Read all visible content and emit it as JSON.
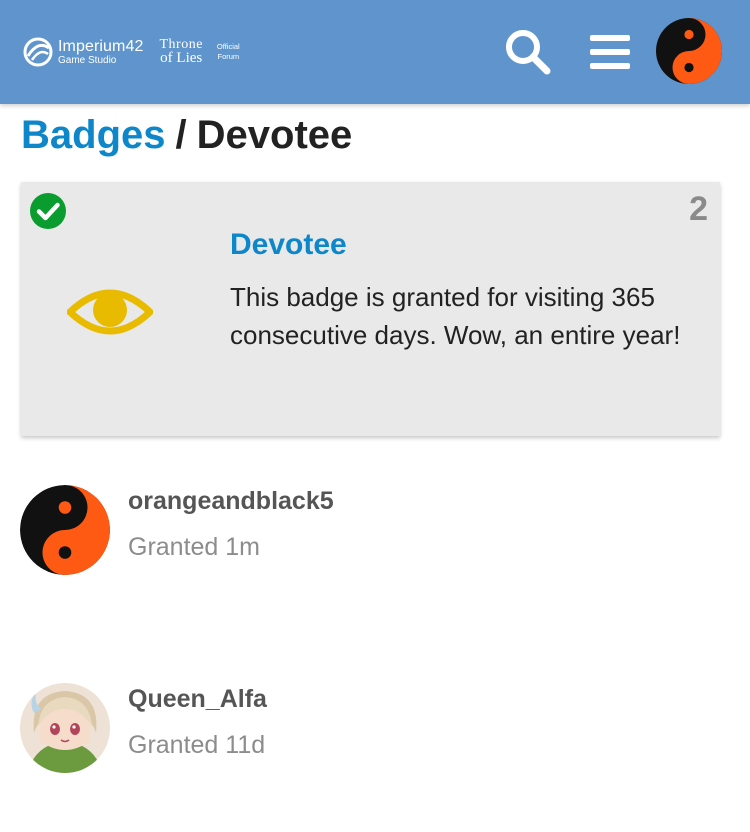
{
  "header": {
    "brand_name": "Imperium42",
    "brand_sub": "Game Studio",
    "game_title_top": "Throne",
    "game_title_bottom": "of Lies",
    "official_line1": "Official",
    "official_line2": "Forum",
    "icons": [
      "imperium42-logo-icon",
      "search-icon",
      "hamburger-menu-icon",
      "yin-yang-avatar"
    ],
    "bg_color": "#5f95cc"
  },
  "breadcrumb": {
    "parent": "Badges",
    "separator": "/",
    "current": "Devotee"
  },
  "badge": {
    "name": "Devotee",
    "description": "This badge is granted for visiting 365 consecutive days. Wow, an entire year!",
    "grant_count": "2",
    "icon": "eye-icon",
    "status_icon": "check-circle-icon",
    "icon_color": "#e9bb00",
    "name_color": "#0d87c9"
  },
  "users": [
    {
      "username": "orangeandblack5",
      "granted": "Granted 1m",
      "avatar": "yin-yang-avatar"
    },
    {
      "username": "Queen_Alfa",
      "granted": "Granted 11d",
      "avatar": "anime-girl-avatar"
    }
  ]
}
